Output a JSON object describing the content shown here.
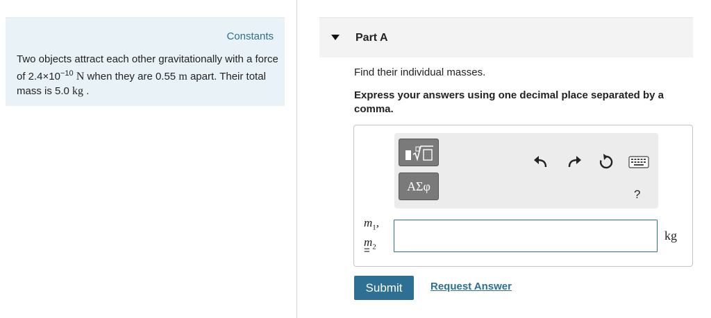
{
  "constants_panel": {
    "link_label": "Constants",
    "problem": {
      "text_1": "Two objects attract each other gravitationally with a force of 2.4×10",
      "exponent": "−10",
      "force_unit": "N",
      "text_2": " when they are 0.55 ",
      "distance_unit": "m",
      "text_3": " apart. Their total mass is 5.0 ",
      "mass_unit": "kg",
      "text_4": " ."
    }
  },
  "part": {
    "title": "Part A",
    "question": "Find their individual masses.",
    "instruction": "Express your answers using one decimal place separated by a comma."
  },
  "answer_box": {
    "toolbar": {
      "symbols_label": "ΑΣφ",
      "help_label": "?"
    },
    "variables": {
      "var1": "m",
      "sub1": "1",
      "sep": ",",
      "var2": "m",
      "sub2": "2",
      "equals": "="
    },
    "input_value": "",
    "unit": "kg"
  },
  "actions": {
    "submit_label": "Submit",
    "request_label": "Request Answer"
  },
  "colors": {
    "accent": "#2d7093",
    "panel_bg": "#e9f3f7"
  },
  "icons": [
    "templates-icon",
    "undo-icon",
    "redo-icon",
    "reset-icon",
    "keyboard-icon",
    "collapse-toggle-icon"
  ]
}
